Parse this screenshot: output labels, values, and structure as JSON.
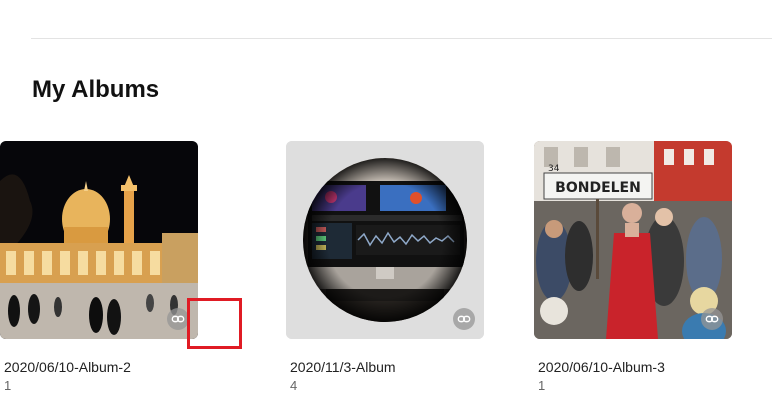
{
  "section": {
    "title": "My Albums"
  },
  "albums": [
    {
      "name": "2020/11/3-Album",
      "count": "4",
      "thumbnail": "desk-computer-video-editing-photo",
      "action_icon": "link-icon"
    },
    {
      "name": "2020/06/10-Album-3",
      "count": "1",
      "thumbnail": "street-parade-woman-red-dress-photo",
      "sign_text": "BONDELEN",
      "sign_number": "34",
      "action_icon": "link-icon"
    },
    {
      "name": "2020/06/10-Album-2",
      "count": "1",
      "thumbnail": "illuminated-mosque-at-night-photo",
      "action_icon": "link-icon"
    }
  ],
  "colors": {
    "highlight": "#e01b24",
    "divider": "#e3e3e3"
  }
}
